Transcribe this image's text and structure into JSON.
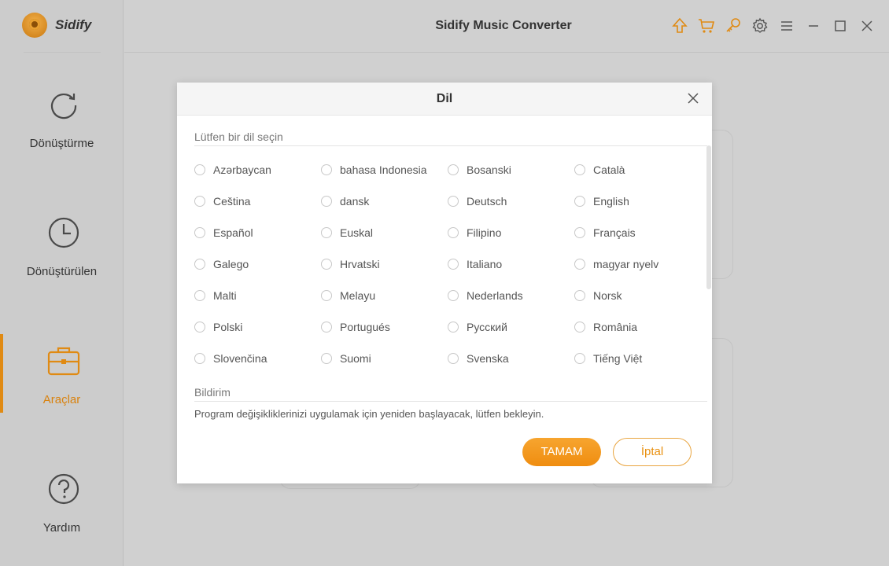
{
  "app": {
    "logo_text": "Sidify",
    "title": "Sidify Music Converter",
    "accent_color": "#EF8D10"
  },
  "sidebar": {
    "items": [
      {
        "label": "Dönüştürme",
        "icon": "refresh-icon"
      },
      {
        "label": "Dönüştürülen",
        "icon": "clock-icon"
      },
      {
        "label": "Araçlar",
        "icon": "toolbox-icon",
        "active": true
      },
      {
        "label": "Yardım",
        "icon": "help-icon"
      }
    ]
  },
  "titlebar": {
    "icons": [
      "upgrade-icon",
      "cart-icon",
      "key-icon",
      "gear-icon",
      "menu-icon",
      "minimize-icon",
      "maximize-icon",
      "close-icon"
    ]
  },
  "dialog": {
    "title": "Dil",
    "select_label": "Lütfen bir dil seçin",
    "languages": [
      "Azərbaycan",
      "bahasa Indonesia",
      "Bosanski",
      "Català",
      "Ceština",
      "dansk",
      "Deutsch",
      "English",
      "Español",
      "Euskal",
      "Filipino",
      "Français",
      "Galego",
      "Hrvatski",
      "Italiano",
      "magyar nyelv",
      "Malti",
      "Melayu",
      "Nederlands",
      "Norsk",
      "Polski",
      "Portugués",
      "Русский",
      "România",
      "Slovenčina",
      "Suomi",
      "Svenska",
      "Tiếng Việt"
    ],
    "notice_label": "Bildirim",
    "notice_text": "Program değişikliklerinizi uygulamak için yeniden başlayacak, lütfen bekleyin.",
    "ok_label": "TAMAM",
    "cancel_label": "İptal"
  }
}
